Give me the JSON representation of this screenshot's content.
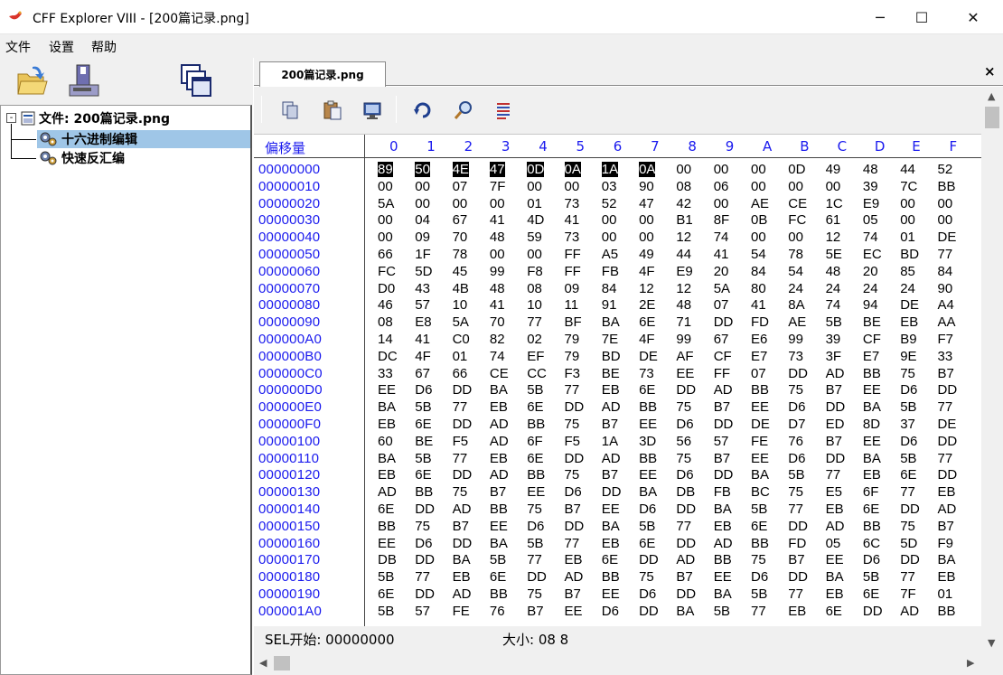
{
  "window": {
    "title": "CFF Explorer VIII - [200篇记录.png]",
    "minimize": "─",
    "maximize": "☐",
    "close": "✕"
  },
  "menu": [
    "文件",
    "设置",
    "帮助"
  ],
  "left_toolbar": {
    "icons": [
      "open-folder-icon",
      "save-disk-icon",
      "windows-icon"
    ]
  },
  "tree": {
    "root": "文件: 200篇记录.png",
    "expand": "-",
    "children": [
      {
        "label": "十六进制编辑",
        "selected": true
      },
      {
        "label": "快速反汇编",
        "selected": false
      }
    ]
  },
  "tab": {
    "label": "200篇记录.png",
    "close": "×"
  },
  "hex_toolbar": {
    "icons": [
      "copy-icon",
      "paste-icon",
      "monitor-icon",
      "refresh-icon",
      "search-icon",
      "list-icon"
    ]
  },
  "hex": {
    "offset_header": "偏移量",
    "columns": [
      "0",
      "1",
      "2",
      "3",
      "4",
      "5",
      "6",
      "7",
      "8",
      "9",
      "A",
      "B",
      "C",
      "D",
      "E",
      "F"
    ],
    "selected_count": 8,
    "rows": [
      {
        "offset": "00000000",
        "bytes": [
          "89",
          "50",
          "4E",
          "47",
          "0D",
          "0A",
          "1A",
          "0A",
          "00",
          "00",
          "00",
          "0D",
          "49",
          "48",
          "44",
          "52"
        ]
      },
      {
        "offset": "00000010",
        "bytes": [
          "00",
          "00",
          "07",
          "7F",
          "00",
          "00",
          "03",
          "90",
          "08",
          "06",
          "00",
          "00",
          "00",
          "39",
          "7C",
          "BB"
        ]
      },
      {
        "offset": "00000020",
        "bytes": [
          "5A",
          "00",
          "00",
          "00",
          "01",
          "73",
          "52",
          "47",
          "42",
          "00",
          "AE",
          "CE",
          "1C",
          "E9",
          "00",
          "00"
        ]
      },
      {
        "offset": "00000030",
        "bytes": [
          "00",
          "04",
          "67",
          "41",
          "4D",
          "41",
          "00",
          "00",
          "B1",
          "8F",
          "0B",
          "FC",
          "61",
          "05",
          "00",
          "00"
        ]
      },
      {
        "offset": "00000040",
        "bytes": [
          "00",
          "09",
          "70",
          "48",
          "59",
          "73",
          "00",
          "00",
          "12",
          "74",
          "00",
          "00",
          "12",
          "74",
          "01",
          "DE"
        ]
      },
      {
        "offset": "00000050",
        "bytes": [
          "66",
          "1F",
          "78",
          "00",
          "00",
          "FF",
          "A5",
          "49",
          "44",
          "41",
          "54",
          "78",
          "5E",
          "EC",
          "BD",
          "77"
        ]
      },
      {
        "offset": "00000060",
        "bytes": [
          "FC",
          "5D",
          "45",
          "99",
          "F8",
          "FF",
          "FB",
          "4F",
          "E9",
          "20",
          "84",
          "54",
          "48",
          "20",
          "85",
          "84"
        ]
      },
      {
        "offset": "00000070",
        "bytes": [
          "D0",
          "43",
          "4B",
          "48",
          "08",
          "09",
          "84",
          "12",
          "12",
          "5A",
          "80",
          "24",
          "24",
          "24",
          "24",
          "90"
        ]
      },
      {
        "offset": "00000080",
        "bytes": [
          "46",
          "57",
          "10",
          "41",
          "10",
          "11",
          "91",
          "2E",
          "48",
          "07",
          "41",
          "8A",
          "74",
          "94",
          "DE",
          "A4"
        ]
      },
      {
        "offset": "00000090",
        "bytes": [
          "08",
          "E8",
          "5A",
          "70",
          "77",
          "BF",
          "BA",
          "6E",
          "71",
          "DD",
          "FD",
          "AE",
          "5B",
          "BE",
          "EB",
          "AA"
        ]
      },
      {
        "offset": "000000A0",
        "bytes": [
          "14",
          "41",
          "C0",
          "82",
          "02",
          "79",
          "7E",
          "4F",
          "99",
          "67",
          "E6",
          "99",
          "39",
          "CF",
          "B9",
          "F7"
        ]
      },
      {
        "offset": "000000B0",
        "bytes": [
          "DC",
          "4F",
          "01",
          "74",
          "EF",
          "79",
          "BD",
          "DE",
          "AF",
          "CF",
          "E7",
          "73",
          "3F",
          "E7",
          "9E",
          "33"
        ]
      },
      {
        "offset": "000000C0",
        "bytes": [
          "33",
          "67",
          "66",
          "CE",
          "CC",
          "F3",
          "BE",
          "73",
          "EE",
          "FF",
          "07",
          "DD",
          "AD",
          "BB",
          "75",
          "B7"
        ]
      },
      {
        "offset": "000000D0",
        "bytes": [
          "EE",
          "D6",
          "DD",
          "BA",
          "5B",
          "77",
          "EB",
          "6E",
          "DD",
          "AD",
          "BB",
          "75",
          "B7",
          "EE",
          "D6",
          "DD"
        ]
      },
      {
        "offset": "000000E0",
        "bytes": [
          "BA",
          "5B",
          "77",
          "EB",
          "6E",
          "DD",
          "AD",
          "BB",
          "75",
          "B7",
          "EE",
          "D6",
          "DD",
          "BA",
          "5B",
          "77"
        ]
      },
      {
        "offset": "000000F0",
        "bytes": [
          "EB",
          "6E",
          "DD",
          "AD",
          "BB",
          "75",
          "B7",
          "EE",
          "D6",
          "DD",
          "DE",
          "D7",
          "ED",
          "8D",
          "37",
          "DE"
        ]
      },
      {
        "offset": "00000100",
        "bytes": [
          "60",
          "BE",
          "F5",
          "AD",
          "6F",
          "F5",
          "1A",
          "3D",
          "56",
          "57",
          "FE",
          "76",
          "B7",
          "EE",
          "D6",
          "DD"
        ]
      },
      {
        "offset": "00000110",
        "bytes": [
          "BA",
          "5B",
          "77",
          "EB",
          "6E",
          "DD",
          "AD",
          "BB",
          "75",
          "B7",
          "EE",
          "D6",
          "DD",
          "BA",
          "5B",
          "77"
        ]
      },
      {
        "offset": "00000120",
        "bytes": [
          "EB",
          "6E",
          "DD",
          "AD",
          "BB",
          "75",
          "B7",
          "EE",
          "D6",
          "DD",
          "BA",
          "5B",
          "77",
          "EB",
          "6E",
          "DD"
        ]
      },
      {
        "offset": "00000130",
        "bytes": [
          "AD",
          "BB",
          "75",
          "B7",
          "EE",
          "D6",
          "DD",
          "BA",
          "DB",
          "FB",
          "BC",
          "75",
          "E5",
          "6F",
          "77",
          "EB"
        ]
      },
      {
        "offset": "00000140",
        "bytes": [
          "6E",
          "DD",
          "AD",
          "BB",
          "75",
          "B7",
          "EE",
          "D6",
          "DD",
          "BA",
          "5B",
          "77",
          "EB",
          "6E",
          "DD",
          "AD"
        ]
      },
      {
        "offset": "00000150",
        "bytes": [
          "BB",
          "75",
          "B7",
          "EE",
          "D6",
          "DD",
          "BA",
          "5B",
          "77",
          "EB",
          "6E",
          "DD",
          "AD",
          "BB",
          "75",
          "B7"
        ]
      },
      {
        "offset": "00000160",
        "bytes": [
          "EE",
          "D6",
          "DD",
          "BA",
          "5B",
          "77",
          "EB",
          "6E",
          "DD",
          "AD",
          "BB",
          "FD",
          "05",
          "6C",
          "5D",
          "F9"
        ]
      },
      {
        "offset": "00000170",
        "bytes": [
          "DB",
          "DD",
          "BA",
          "5B",
          "77",
          "EB",
          "6E",
          "DD",
          "AD",
          "BB",
          "75",
          "B7",
          "EE",
          "D6",
          "DD",
          "BA"
        ]
      },
      {
        "offset": "00000180",
        "bytes": [
          "5B",
          "77",
          "EB",
          "6E",
          "DD",
          "AD",
          "BB",
          "75",
          "B7",
          "EE",
          "D6",
          "DD",
          "BA",
          "5B",
          "77",
          "EB"
        ]
      },
      {
        "offset": "00000190",
        "bytes": [
          "6E",
          "DD",
          "AD",
          "BB",
          "75",
          "B7",
          "EE",
          "D6",
          "DD",
          "BA",
          "5B",
          "77",
          "EB",
          "6E",
          "7F",
          "01"
        ]
      },
      {
        "offset": "000001A0",
        "bytes": [
          "5B",
          "57",
          "FE",
          "76",
          "B7",
          "EE",
          "D6",
          "DD",
          "BA",
          "5B",
          "77",
          "EB",
          "6E",
          "DD",
          "AD",
          "BB"
        ]
      }
    ]
  },
  "status": {
    "sel_start": "SEL开始: 00000000",
    "size": "大小: 08 8"
  },
  "colors": {
    "offset_blue": "#1a1aee",
    "selection_bg": "#000000",
    "tree_selected_bg": "#9fc6e7"
  }
}
